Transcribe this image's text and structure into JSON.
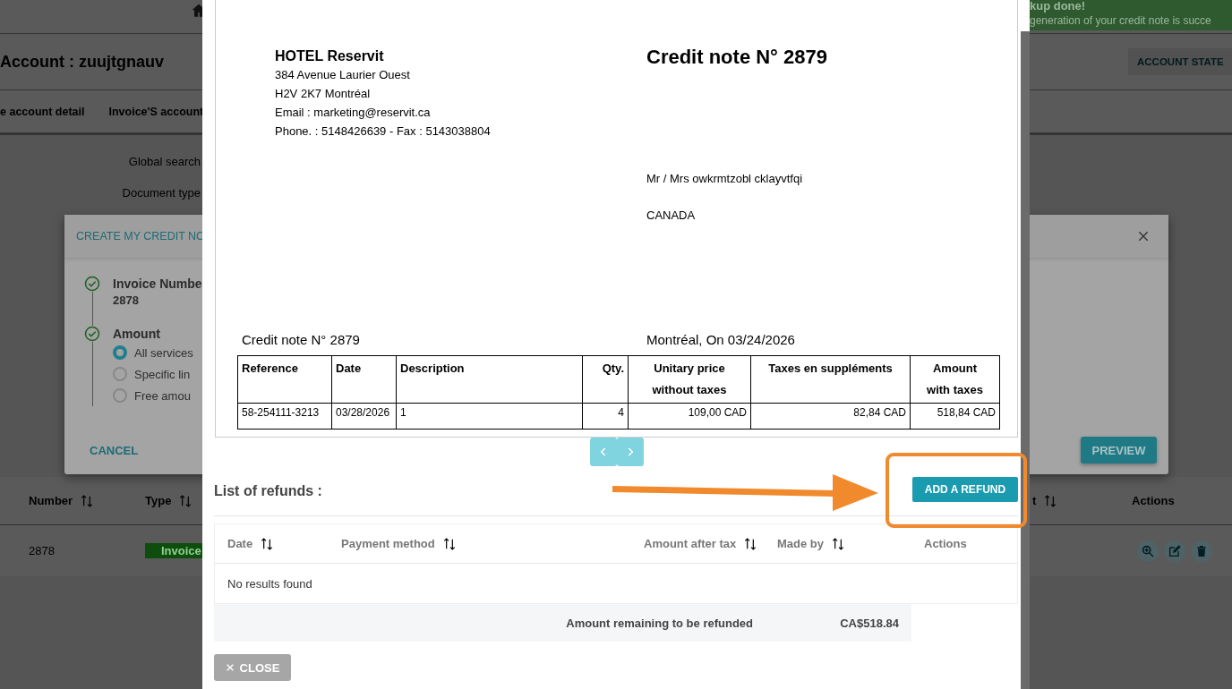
{
  "page": {
    "toast": {
      "title": "kup done!",
      "message": "generation of your credit note is succe"
    },
    "account_title": "Account : zuujtgnauv",
    "account_state_button": "ACCOUNT STATE",
    "tabs": [
      {
        "label": "e account detail",
        "selected": false
      },
      {
        "label": "Invoice'S account",
        "selected": false
      }
    ],
    "filters": [
      "Global search",
      "Document type"
    ],
    "table": {
      "columns": [
        {
          "label": "Number",
          "sortable": true
        },
        {
          "label": "Type",
          "sortable": true
        },
        {
          "label": "t",
          "sortable": true
        },
        {
          "label": "Actions"
        }
      ],
      "rows": [
        {
          "number": "2878",
          "type": "Invoice"
        }
      ]
    }
  },
  "credit_dialog": {
    "title": "CREATE MY CREDIT NO",
    "steps": [
      {
        "title": "Invoice Numbe",
        "value": "2878",
        "done": true
      },
      {
        "title": "Amount",
        "done": true,
        "options": [
          {
            "label": "All services",
            "selected": true
          },
          {
            "label": "Specific lin",
            "selected": false
          },
          {
            "label": "Free amou",
            "selected": false
          }
        ]
      }
    ],
    "cancel_button": "CANCEL",
    "preview_button": "PREVIEW"
  },
  "preview": {
    "document": {
      "issuer": {
        "name": "HOTEL Reservit",
        "lines": [
          "384 Avenue Laurier Ouest",
          "H2V 2K7 Montréal",
          "Email : marketing@reservit.ca",
          "Phone. : 5148426639 - Fax : 5143038804"
        ]
      },
      "title": "Credit note N° 2879",
      "recipient": [
        "Mr / Mrs owkrmtzobl cklayvtfqi",
        "CANADA"
      ],
      "reference_line": "Credit note N° 2879",
      "place_date": "Montréal, On 03/24/2026",
      "table": {
        "columns": [
          "Reference",
          "Date",
          "Description",
          "Qty.",
          "Unitary price without taxes",
          "Taxes en suppléments",
          "Amount with taxes"
        ],
        "rows": [
          [
            "58-254111-3213",
            "03/28/2026",
            "1",
            "4",
            "109,00 CAD",
            "82,84 CAD",
            "518,84 CAD"
          ]
        ]
      }
    },
    "refunds": {
      "title": "List of refunds :",
      "add_button": "ADD A REFUND",
      "columns": [
        {
          "label": "Date",
          "sortable": true
        },
        {
          "label": "Payment method",
          "sortable": true
        },
        {
          "label": "Amount after tax",
          "sortable": true
        },
        {
          "label": "Made by",
          "sortable": true
        },
        {
          "label": "Actions"
        }
      ],
      "empty_text": "No results found",
      "total_label": "Amount remaining to be refunded",
      "total_value": "CA$518.84"
    },
    "close_button": "CLOSE"
  }
}
